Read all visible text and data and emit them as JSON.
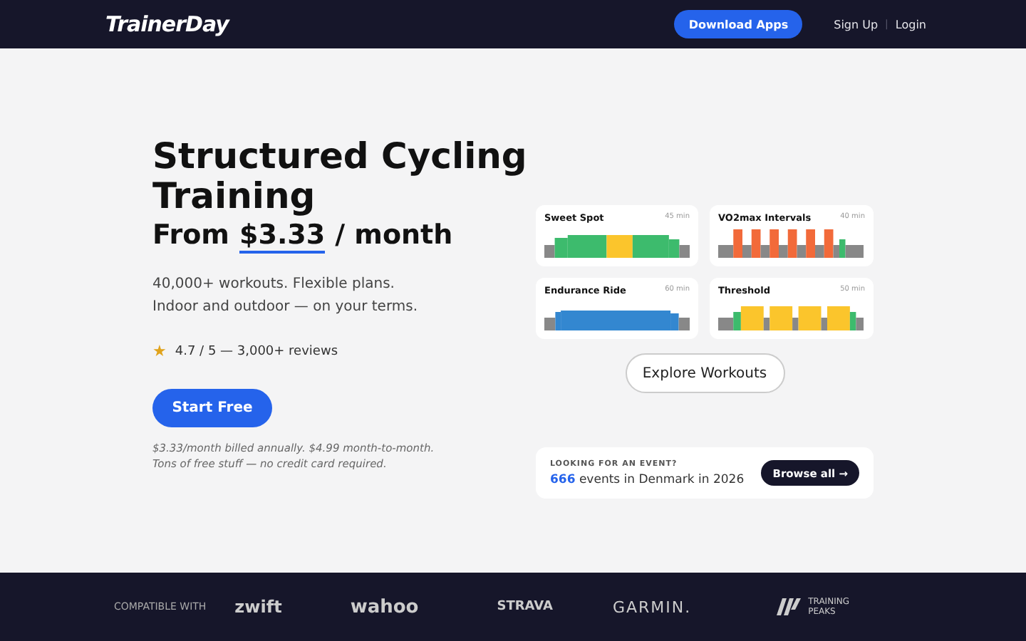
{
  "header": {
    "logo": "TrainerDay",
    "download_button": "Download Apps",
    "links": [
      "Sign Up",
      "Login"
    ],
    "separator": "|"
  },
  "hero": {
    "title": "Structured Cycling Training",
    "price_prefix": "From",
    "price": "$3.33",
    "price_suffix": "/ month",
    "subtitle_lines": [
      "40,000+ workouts. Flexible plans.",
      "Indoor and outdoor — on your terms."
    ],
    "rating_star": "★",
    "rating": "4.7 / 5 — 3,000+ reviews",
    "cta": "Start Free",
    "fine_print_lines": [
      "$3.33/month billed annually. $4.99 month-to-month.",
      "Tons of free stuff — no credit card required."
    ]
  },
  "workouts": [
    {
      "name": "Sweet Spot",
      "duration": "45 min",
      "kind": "sweet-spot"
    },
    {
      "name": "VO2max Intervals",
      "duration": "40 min",
      "kind": "vo2max"
    },
    {
      "name": "Endurance Ride",
      "duration": "60 min",
      "kind": "endurance"
    },
    {
      "name": "Threshold",
      "duration": "50 min",
      "kind": "threshold"
    }
  ],
  "explore_button": "Explore Workouts",
  "events": {
    "label": "LOOKING FOR AN EVENT?",
    "count": "666",
    "text": "events in Denmark in 2026",
    "button": "Browse all →"
  },
  "footer": {
    "label": "COMPATIBLE WITH",
    "partners": [
      "zwift",
      "wahoo",
      "STRAVA",
      "GARMIN.",
      "TRAINING PEAKS"
    ]
  }
}
